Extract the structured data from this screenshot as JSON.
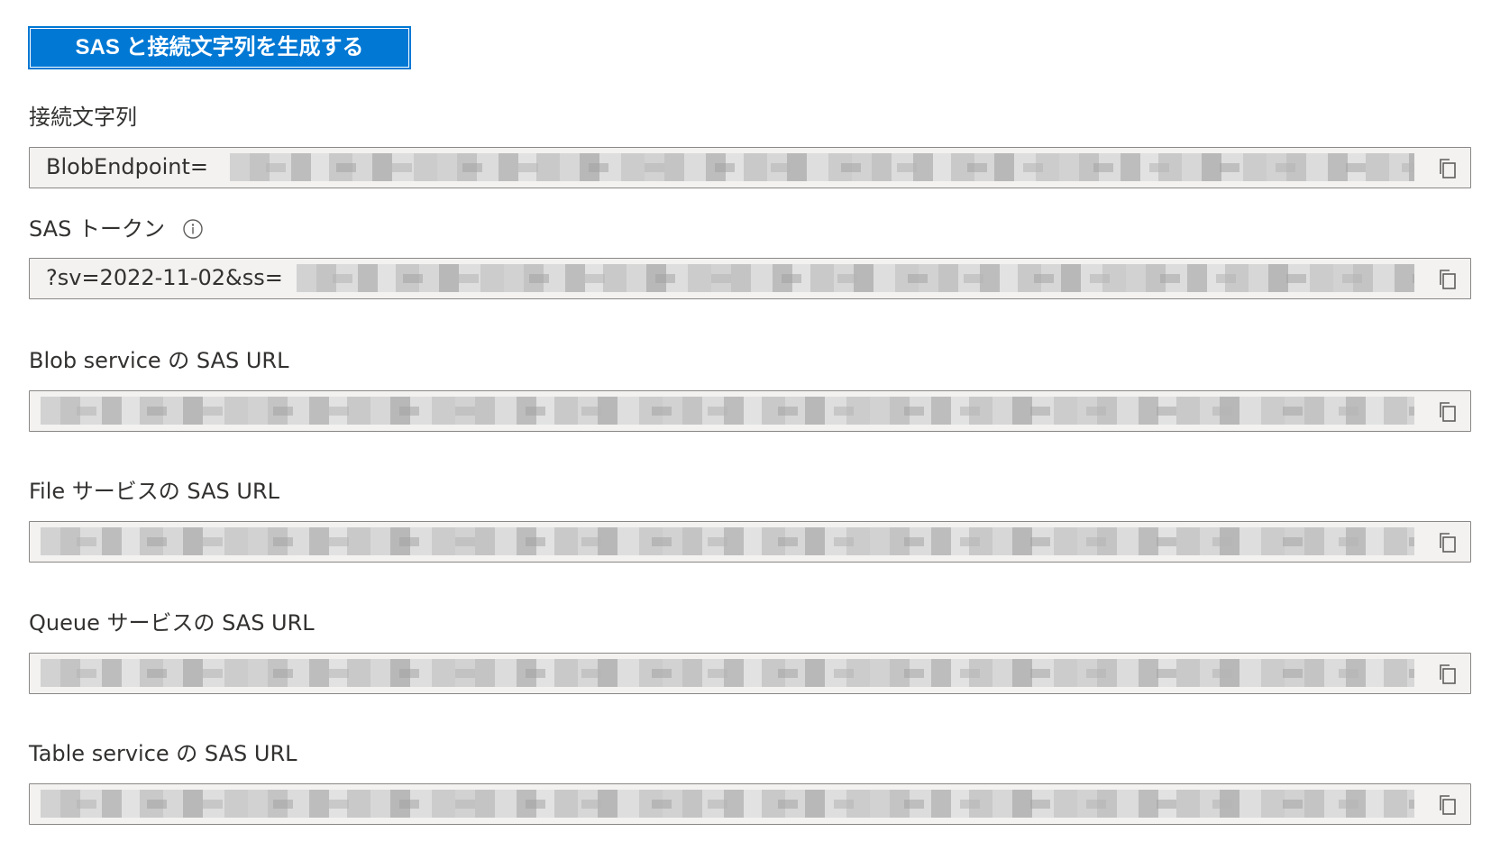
{
  "generate_button": {
    "label": "SAS と接続文字列を生成する"
  },
  "fields": [
    {
      "label": "接続文字列",
      "value": "BlobEndpoint=",
      "copy_icon": "copy-icon"
    },
    {
      "label": "SAS トークン",
      "value": "?sv=2022-11-02&ss=",
      "info_icon": "info-icon",
      "copy_icon": "copy-icon"
    },
    {
      "label": "Blob service の SAS URL",
      "value": "",
      "copy_icon": "copy-icon"
    },
    {
      "label": "File サービスの SAS URL",
      "value": "",
      "copy_icon": "copy-icon"
    },
    {
      "label": "Queue サービスの SAS URL",
      "value": "",
      "copy_icon": "copy-icon"
    },
    {
      "label": "Table service の SAS URL",
      "value": "",
      "copy_icon": "copy-icon"
    }
  ],
  "colors": {
    "accent": "#0078d4",
    "field_background": "#f3f2f1",
    "field_border": "#8a8886",
    "text": "#323130"
  }
}
